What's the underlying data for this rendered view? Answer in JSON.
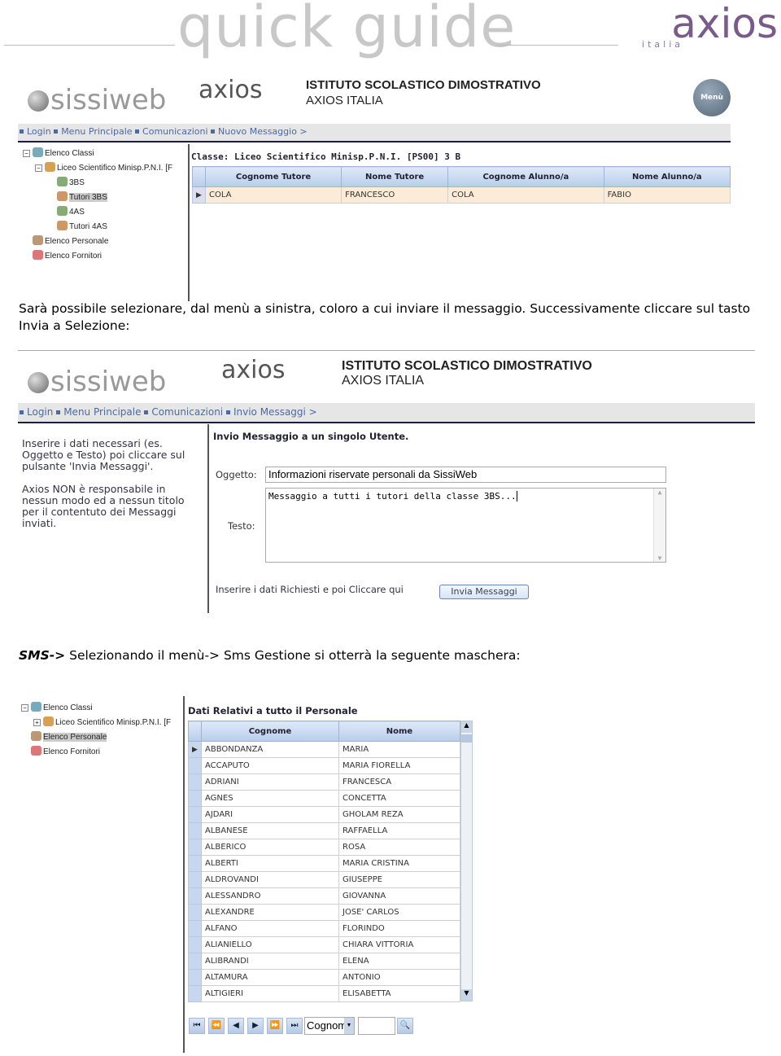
{
  "banner": {
    "title": "quick guide",
    "brand": "axios",
    "brand_sub": "italia"
  },
  "shot1": {
    "logo": "sissiweb",
    "axios": "axios",
    "institute": "ISTITUTO SCOLASTICO DIMOSTRATIVO",
    "org": "AXIOS ITALIA",
    "menu_button": "Menù",
    "breadcrumb": [
      "Login",
      "Menu Principale",
      "Comunicazioni",
      "Nuovo Messaggio >"
    ],
    "tree": [
      "Elenco Classi",
      "Liceo Scientifico Minisp.P.N.I. [F",
      "3BS",
      "Tutori 3BS",
      "4AS",
      "Tutori 4AS",
      "Elenco Personale",
      "Elenco Fornitori"
    ],
    "class_title": "Classe: Liceo Scientifico Minisp.P.N.I. [PS00] 3 B",
    "columns": [
      "Cognome Tutore",
      "Nome Tutore",
      "Cognome Alunno/a",
      "Nome Alunno/a"
    ],
    "rows": [
      [
        "COLA",
        "FRANCESCO",
        "COLA",
        "FABIO"
      ]
    ]
  },
  "para1": "Sarà possibile selezionare, dal menù a sinistra, coloro a cui inviare il messaggio. Successivamente cliccare sul tasto Invia a Selezione:",
  "shot2": {
    "logo": "sissiweb",
    "axios": "axios",
    "institute": "ISTITUTO SCOLASTICO DIMOSTRATIVO",
    "org": "AXIOS ITALIA",
    "breadcrumb": [
      "Login",
      "Menu Principale",
      "Comunicazioni",
      "Invio Messaggi >"
    ],
    "help1": "Inserire i dati necessari (es. Oggetto e Testo) poi cliccare sul pulsante 'Invia Messaggi'.",
    "help2": "Axios NON è responsabile in nessun modo ed a nessun titolo per il contentuto dei Messaggi inviati.",
    "title": "Invio Messaggio a un singolo Utente.",
    "subject_label": "Oggetto:",
    "subject_value": "Informazioni riservate personali da SissiWeb",
    "text_label": "Testo:",
    "text_value": "Messaggio a tutti i tutori della classe 3BS...",
    "hint": "Inserire i dati Richiesti e poi Cliccare qui",
    "send_button": "Invia Messaggi"
  },
  "para2": {
    "bold": "SMS->",
    "rest": " Selezionando il menù-> Sms Gestione si otterrà la seguente maschera:"
  },
  "shot3": {
    "tree": [
      "Elenco Classi",
      "Liceo Scientifico Minisp.P.N.I. [F",
      "Elenco Personale",
      "Elenco Fornitori"
    ],
    "title": "Dati Relativi a tutto il Personale",
    "columns": [
      "Cognome",
      "Nome"
    ],
    "rows": [
      [
        "ABBONDANZA",
        "MARIA"
      ],
      [
        "ACCAPUTO",
        "MARIA FIORELLA"
      ],
      [
        "ADRIANI",
        "FRANCESCA"
      ],
      [
        "AGNES",
        "CONCETTA"
      ],
      [
        "AJDARI",
        "GHOLAM REZA"
      ],
      [
        "ALBANESE",
        "RAFFAELLA"
      ],
      [
        "ALBERICO",
        "ROSA"
      ],
      [
        "ALBERTI",
        "MARIA CRISTINA"
      ],
      [
        "ALDROVANDI",
        "GIUSEPPE"
      ],
      [
        "ALESSANDRO",
        "GIOVANNA"
      ],
      [
        "ALEXANDRE",
        "JOSE' CARLOS"
      ],
      [
        "ALFANO",
        "FLORINDO"
      ],
      [
        "ALIANIELLO",
        "CHIARA VITTORIA"
      ],
      [
        "ALIBRANDI",
        "ELENA"
      ],
      [
        "ALTAMURA",
        "ANTONIO"
      ],
      [
        "ALTIGIERI",
        "ELISABETTA"
      ]
    ],
    "search_field": "Cognom",
    "pager": [
      "first",
      "prev-page",
      "prev",
      "next",
      "next-page",
      "last"
    ]
  }
}
